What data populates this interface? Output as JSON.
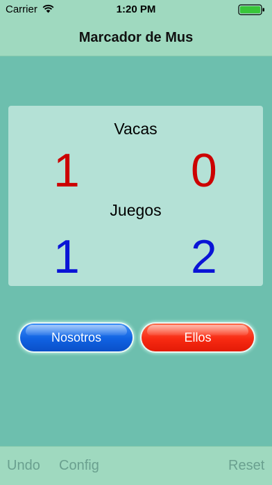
{
  "status_bar": {
    "carrier": "Carrier",
    "time": "1:20 PM"
  },
  "nav": {
    "title": "Marcador de Mus"
  },
  "scoreboard": {
    "vacas_label": "Vacas",
    "vacas": {
      "nosotros": "1",
      "ellos": "0"
    },
    "juegos_label": "Juegos",
    "juegos": {
      "nosotros": "1",
      "ellos": "2"
    }
  },
  "buttons": {
    "nosotros": "Nosotros",
    "ellos": "Ellos"
  },
  "toolbar": {
    "undo": "Undo",
    "config": "Config",
    "reset": "Reset"
  },
  "colors": {
    "background": "#6dbfae",
    "bar": "#9fd9bf",
    "card": "#b4e1d6",
    "vacas_score": "#cc0000",
    "juegos_score": "#0a14d6",
    "nosotros_button": "#1062e2",
    "ellos_button": "#f82a12",
    "toolbar_text": "#6aa08f"
  },
  "icons": {
    "wifi": "wifi-icon",
    "battery": "battery-icon"
  }
}
